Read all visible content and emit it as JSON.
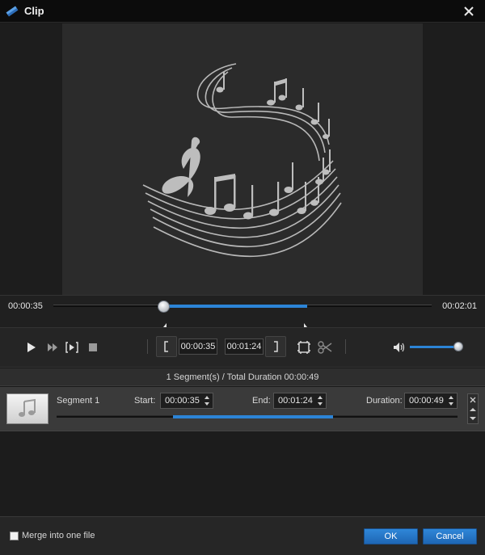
{
  "window": {
    "title": "Clip"
  },
  "timeline": {
    "current_time": "00:00:35",
    "total_time": "00:02:01",
    "start_fraction": 0.29,
    "end_fraction": 0.67
  },
  "controls": {
    "start_time": "00:00:35",
    "end_time": "00:01:24",
    "volume_fraction": 0.9
  },
  "summary": "1 Segment(s) / Total Duration 00:00:49",
  "segments": [
    {
      "name": "Segment 1",
      "start_label": "Start:",
      "start": "00:00:35",
      "end_label": "End:",
      "end": "00:01:24",
      "duration_label": "Duration:",
      "duration": "00:00:49",
      "range_start_fraction": 0.29,
      "range_end_fraction": 0.69
    }
  ],
  "footer": {
    "merge_label": "Merge into one file",
    "merge_checked": false,
    "ok_label": "OK",
    "cancel_label": "Cancel"
  },
  "colors": {
    "accent": "#2c84d6",
    "background": "#1a1a1a"
  },
  "icons": [
    "app-icon",
    "close-icon",
    "music-notes-artwork",
    "play-icon",
    "fast-forward-icon",
    "frame-step-icon",
    "stop-icon",
    "set-start-bracket-icon",
    "set-end-bracket-icon",
    "crop-icon",
    "scissors-icon",
    "volume-icon",
    "music-note-icon",
    "remove-icon",
    "move-up-icon",
    "move-down-icon"
  ]
}
